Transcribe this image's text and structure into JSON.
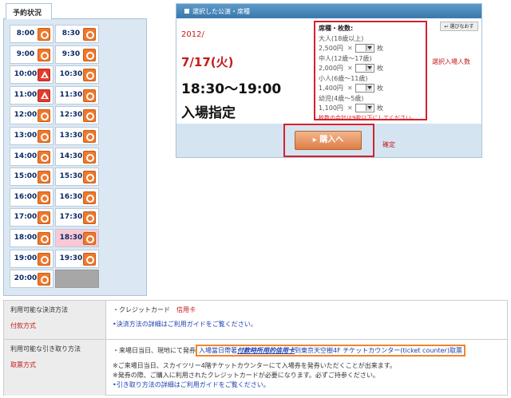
{
  "schedule": {
    "tab_label": "予約状況",
    "rows": [
      [
        {
          "time": "8:00",
          "status": "circle"
        },
        {
          "time": "8:30",
          "status": "circle"
        }
      ],
      [
        {
          "time": "9:00",
          "status": "circle"
        },
        {
          "time": "9:30",
          "status": "circle"
        }
      ],
      [
        {
          "time": "10:00",
          "status": "triangle"
        },
        {
          "time": "10:30",
          "status": "circle"
        }
      ],
      [
        {
          "time": "11:00",
          "status": "triangle"
        },
        {
          "time": "11:30",
          "status": "circle"
        }
      ],
      [
        {
          "time": "12:00",
          "status": "circle"
        },
        {
          "time": "12:30",
          "status": "circle"
        }
      ],
      [
        {
          "time": "13:00",
          "status": "circle"
        },
        {
          "time": "13:30",
          "status": "circle"
        }
      ],
      [
        {
          "time": "14:00",
          "status": "circle"
        },
        {
          "time": "14:30",
          "status": "circle"
        }
      ],
      [
        {
          "time": "15:00",
          "status": "circle"
        },
        {
          "time": "15:30",
          "status": "circle"
        }
      ],
      [
        {
          "time": "16:00",
          "status": "circle"
        },
        {
          "time": "16:30",
          "status": "circle"
        }
      ],
      [
        {
          "time": "17:00",
          "status": "circle"
        },
        {
          "time": "17:30",
          "status": "circle"
        }
      ],
      [
        {
          "time": "18:00",
          "status": "circle"
        },
        {
          "time": "18:30",
          "status": "circle",
          "selected": true
        }
      ],
      [
        {
          "time": "19:00",
          "status": "circle"
        },
        {
          "time": "19:30",
          "status": "circle"
        }
      ],
      [
        {
          "time": "20:00",
          "status": "circle"
        },
        {
          "time": "",
          "status": "empty"
        }
      ]
    ]
  },
  "selection": {
    "header": "選択した公演・席種",
    "year": "2012/",
    "date": "7/17(火)",
    "time_range": "18:30～19:00",
    "admission": "入場指定",
    "back_button": "選びなおす",
    "seats_label": "選択入場人数",
    "seat_title": "席種・枚数:",
    "categories": [
      {
        "name": "大人(18歳以上)",
        "price": "2,500円",
        "x": "✕",
        "qty": "",
        "unit": "枚"
      },
      {
        "name": "中人(12歳～17歳)",
        "price": "2,000円",
        "x": "✕",
        "qty": "",
        "unit": "枚"
      },
      {
        "name": "小人(6歳～11歳)",
        "price": "1,400円",
        "x": "✕",
        "qty": "",
        "unit": "枚"
      },
      {
        "name": "幼児(4歳～5歳)",
        "price": "1,100円",
        "x": "✕",
        "qty": "",
        "unit": "枚"
      }
    ],
    "seat_note": "枚数の合計は9枚以下にしてください。",
    "buy_button": "購入へ",
    "confirm_label": "確定"
  },
  "info": {
    "payment": {
      "label": "利用可能な決済方法",
      "sub": "付款方式",
      "method": "・クレジットカード",
      "method_sub": "信用卡",
      "guide": "•決済方法の詳細はご利用ガイドをご覧ください。"
    },
    "pickup": {
      "label": "利用可能な引き取り方法",
      "sub": "取票方式",
      "method_prefix": "・来場日当日、現地にて発券",
      "highlight_a": "入場當日帶著",
      "highlight_b": "付款時所用的信用卡",
      "highlight_c": "到東京天空樹4F チケットカウンター(ticket counter)取票",
      "note1": "※ご来場日当日、スカイツリー4階チケットカウンターにて入場券を発券いただくことが出来ます。",
      "note2": "※発券の際、ご購入に利用されたクレジットカードが必要になります。必ずご持参ください。",
      "guide": "•引き取り方法の詳細はご利用ガイドをご覧ください。"
    }
  }
}
